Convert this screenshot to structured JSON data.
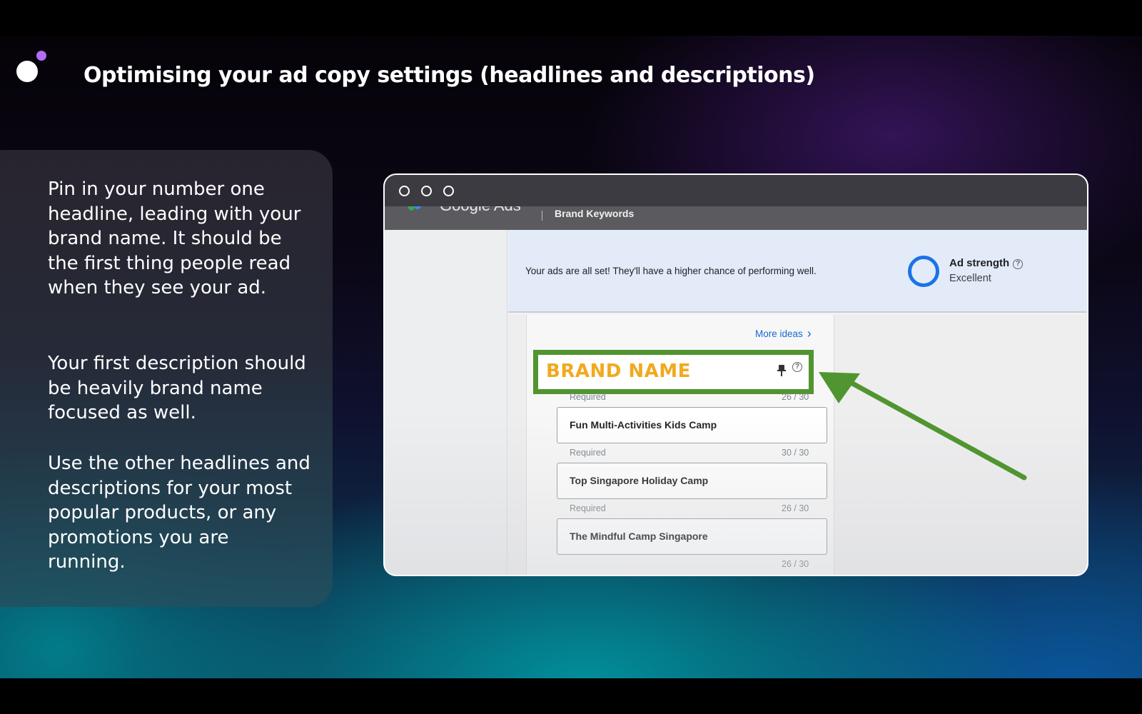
{
  "slide": {
    "title": "Optimising your ad copy settings (headlines and descriptions)",
    "paragraphs": [
      "Pin in your number one headline, leading with your brand name. It should be the first thing people read when they see your ad.",
      "Your first description should be heavily brand name focused as well.",
      "Use the other headlines and descriptions for your most popular products, or any promotions you are running."
    ],
    "colors": {
      "accent_dot": "#b36cf2",
      "highlight_border": "#519530",
      "brand_text": "#f2a91e"
    }
  },
  "screenshot": {
    "header": {
      "app_name": "Google Ads",
      "campaign": "Brand Keywords"
    },
    "banner": {
      "message": "Your ads are all set! They'll have a higher chance of performing well.",
      "ad_strength_label": "Ad strength",
      "ad_strength_value": "Excellent"
    },
    "more_ideas": "More ideas",
    "headlines": [
      {
        "text": "BRAND NAME",
        "label": "Required",
        "count": "26 / 30"
      },
      {
        "text": "Fun Multi-Activities Kids Camp",
        "label": "Required",
        "count": "30 / 30"
      },
      {
        "text": "Top Singapore Holiday Camp",
        "label": "Required",
        "count": "26 / 30"
      },
      {
        "text": "The Mindful Camp Singapore",
        "count": "26 / 30"
      }
    ],
    "icons": [
      "pin-icon",
      "help-icon",
      "chevron-right-icon",
      "ad-strength-ring-icon",
      "arrow-icon"
    ]
  }
}
